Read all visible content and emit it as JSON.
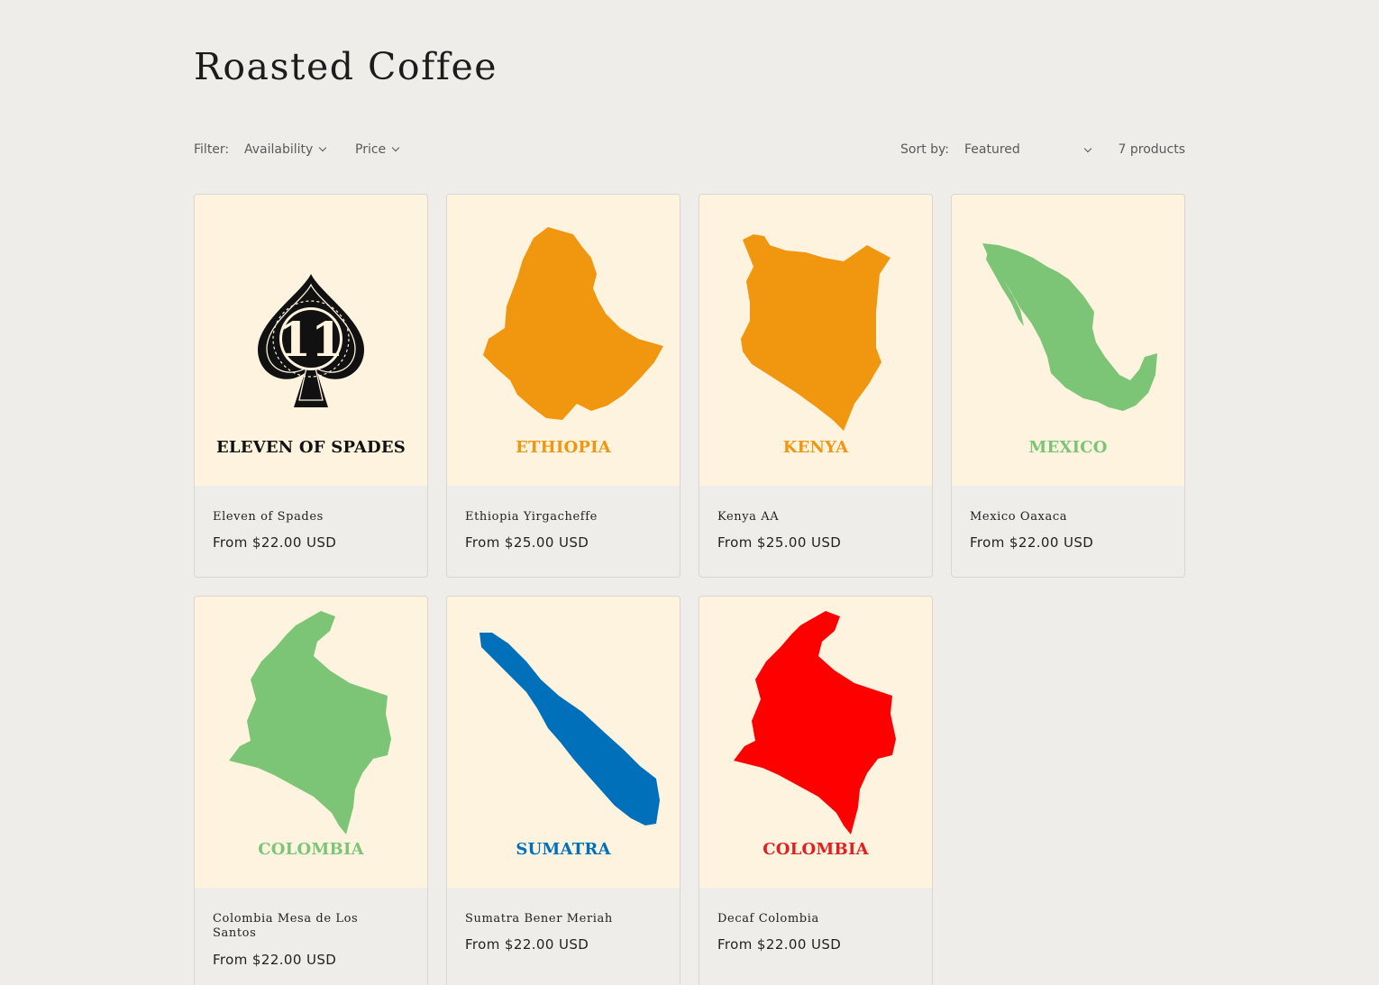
{
  "collection": {
    "title": "Roasted Coffee"
  },
  "toolbar": {
    "filter_label": "Filter:",
    "availability_label": "Availability",
    "price_label": "Price",
    "sort_label": "Sort by:",
    "sort_value": "Featured",
    "product_count": "7 products"
  },
  "products": [
    {
      "name": "Eleven of Spades",
      "price": "From $22.00 USD",
      "image_label": "ELEVEN OF SPADES",
      "image_number": "11",
      "icon": "spade-icon",
      "color": "#111111"
    },
    {
      "name": "Ethiopia Yirgacheffe",
      "price": "From $25.00 USD",
      "image_label": "ETHIOPIA",
      "icon": "ethiopia-map-icon",
      "color": "#f0960f"
    },
    {
      "name": "Kenya AA",
      "price": "From $25.00 USD",
      "image_label": "KENYA",
      "icon": "kenya-map-icon",
      "color": "#f0960f"
    },
    {
      "name": "Mexico Oaxaca",
      "price": "From $22.00 USD",
      "image_label": "MEXICO",
      "icon": "mexico-map-icon",
      "color": "#7dc576"
    },
    {
      "name": "Colombia Mesa de Los Santos",
      "price": "From $22.00 USD",
      "image_label": "COLOMBIA",
      "icon": "colombia-map-icon",
      "color": "#7dc576"
    },
    {
      "name": "Sumatra Bener Meriah",
      "price": "From $22.00 USD",
      "image_label": "SUMATRA",
      "icon": "sumatra-map-icon",
      "color": "#0070bb"
    },
    {
      "name": "Decaf Colombia",
      "price": "From $22.00 USD",
      "image_label": "COLOMBIA",
      "icon": "colombia-map-icon",
      "color": "#ff0000"
    }
  ]
}
